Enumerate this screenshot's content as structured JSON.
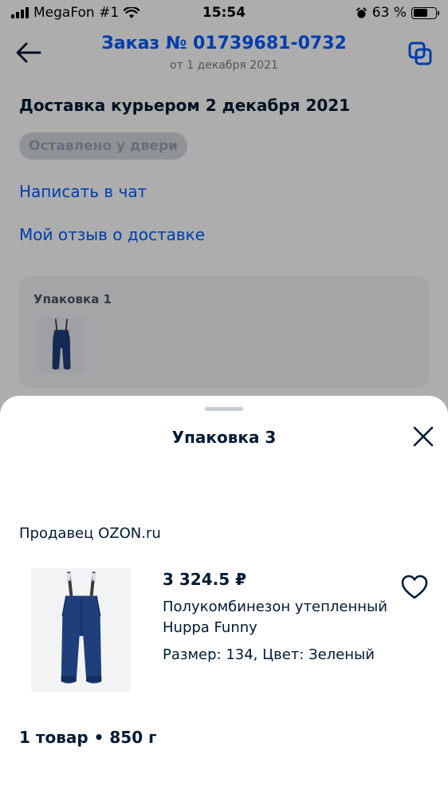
{
  "status_bar": {
    "carrier": "MegaFon #1",
    "time": "15:54",
    "battery_text": "63 %",
    "battery_level": 0.63
  },
  "header": {
    "title": "Заказ № 01739681-0732",
    "subtitle": "от 1 декабря 2021",
    "back_icon": "arrow-left-icon",
    "copy_icon": "copy-icon"
  },
  "delivery": {
    "title": "Доставка курьером 2 декабря 2021",
    "status": "Оставлено у двери",
    "chat_link": "Написать в чат",
    "review_link": "Мой отзыв о доставке"
  },
  "package_card": {
    "title": "Упаковка 1"
  },
  "sheet": {
    "title": "Упаковка 3",
    "seller": "Продавец OZON.ru",
    "product": {
      "price": "3 324.5 ₽",
      "name": "Полукомбинезон утепленный Huppa Funny",
      "attributes": "Размер: 134, Цвет: Зеленый"
    },
    "summary": "1 товар • 850 г"
  },
  "colors": {
    "accent": "#005bff",
    "text": "#001a34",
    "secondary_text": "#707f8d",
    "overlay": "rgba(0,0,0,0.32)",
    "product_navy": "#1f3f7a"
  }
}
